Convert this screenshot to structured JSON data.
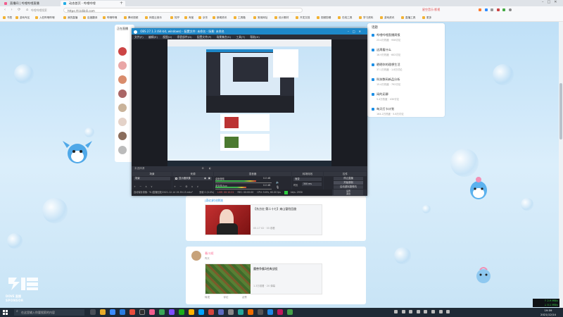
{
  "browser": {
    "tabs": [
      {
        "label": "直播间 | 哔哩哔哩直播",
        "active": false,
        "color": "#f25d8e"
      },
      {
        "label": "动态首页 - 哔哩哔哩",
        "active": true,
        "color": "#23ade5"
      }
    ],
    "address": "https://t.bilibili.com",
    "search_placeholder": "哔哩哔哩搜索",
    "bookmarks": [
      "书签",
      "游戏专区",
      "入驻哔哩哔哩",
      "我的直播",
      "百度翻译",
      "哔哩哔哩",
      "腾讯视频",
      "网易云音乐",
      "知乎",
      "淘宝",
      "京东",
      "新闻资讯",
      "工具箱",
      "常用网址",
      "设计素材",
      "开发文档",
      "视频剪辑",
      "在线工具",
      "学习资料",
      "游戏资讯",
      "直播工具",
      "更多"
    ],
    "extensions_label": "星空音乐·影视"
  },
  "left_panel": {
    "title": "正在直播"
  },
  "right_panel": {
    "title": "话题",
    "items": [
      {
        "title": "哔哩哔哩直播周报",
        "sub": "23.4万热度 · 958讨论"
      },
      {
        "title": "这周看什么",
        "sub": "16.9万热度 · 602讨论"
      },
      {
        "title": "晒晒你的理想生活",
        "sub": "37.1万热度 · 1.8万讨论"
      },
      {
        "title": "科技数码新品分析",
        "sub": "15.4万热度 · 792讨论"
      },
      {
        "title": "闲的无聊",
        "sub": "5.4万热度 · 430讨论"
      },
      {
        "title": "每天打卡计划",
        "sub": "164.2万热度 · 5.8万讨论"
      }
    ]
  },
  "feed": {
    "card1": {
      "label": "[奇幻]时光倒流",
      "title": "【东方红·第二十七】来山冒险回旋",
      "meta": "05-17 02 · 33 观看"
    },
    "card2": {
      "user": "春川姬",
      "time": "昨天",
      "title": "魔兽争霸3经典战役",
      "meta": "1.3万观看 · 20 弹幕"
    },
    "actions": [
      "转发",
      "评论",
      "点赞"
    ]
  },
  "obs": {
    "title": "OBS 27.1.3 (64-bit, windows) - 配置文件: 未命名 - 场景: 未命名",
    "menu": [
      "文件(F)",
      "编辑(E)",
      "视图(V)",
      "停靠部件(D)",
      "配置文件(P)",
      "场景集合(S)",
      "工具(T)",
      "帮助(H)"
    ],
    "source_hint": "未选择源",
    "scenes_title": "场景",
    "scene_item": "场景",
    "sources_title": "来源",
    "source_item": "显示器采集",
    "mixer_title": "混音器",
    "mixer": [
      {
        "name": "桌面音频",
        "db": "0.0 dB",
        "level": 0.72
      },
      {
        "name": "麦克风/Aux",
        "db": "0.0 dB",
        "level": 0.55
      }
    ],
    "transition_title": "转场特效",
    "transition_value": "渐变",
    "duration_label": "时长",
    "duration_value": "300 ms",
    "controls_title": "控件",
    "controls": [
      "停止直播",
      "开始录制",
      "启动虚拟摄像机",
      "工作室模式",
      "设置",
      "退出"
    ],
    "status_left": "自动保存录像: \"K:/直播回放/2021-12-14 19-59-15.mkv\"",
    "status_items": [
      "丢帧 0 (0.0%)",
      "LIVE: 00:10:21",
      "REC: 00:00:00",
      "CPU: 9.6%, 60.00 fps",
      "kb/s: 2930"
    ]
  },
  "logo": {
    "text": "DOVE 直播",
    "sub": "SPONSOR"
  },
  "taskbar": {
    "search": "在这里输入你要搜索的内容",
    "time": "19:59",
    "date": "2021/12/14",
    "net_up": "↑ 2.9 MB/s",
    "net_down": "↓ 0.1 MB/s"
  }
}
